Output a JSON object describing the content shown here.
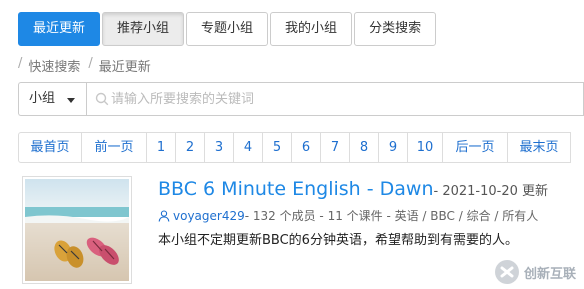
{
  "tabs": [
    {
      "label": "最近更新",
      "state": "active"
    },
    {
      "label": "推荐小组",
      "state": "pressed"
    },
    {
      "label": "专题小组",
      "state": "normal"
    },
    {
      "label": "我的小组",
      "state": "normal"
    },
    {
      "label": "分类搜索",
      "state": "normal"
    }
  ],
  "breadcrumb": [
    "快速搜索",
    "最近更新"
  ],
  "search": {
    "type_label": "小组",
    "placeholder": "请输入所要搜索的关键词"
  },
  "pagination": [
    "最首页",
    "前一页",
    "1",
    "2",
    "3",
    "4",
    "5",
    "6",
    "7",
    "8",
    "9",
    "10",
    "后一页",
    "最末页"
  ],
  "item": {
    "title": "BBC 6 Minute English - Dawn",
    "date_suffix": "- 2021-10-20 更新",
    "user": "voyager429",
    "meta": " - 132 个成员 - 11 个课件 - 英语 / BBC / 综合 / 所有人",
    "description": "本小组不定期更新BBC的6分钟英语，希望帮助到有需要的人。"
  },
  "watermark": {
    "text": "创新互联"
  },
  "colors": {
    "accent": "#1e88e5",
    "link": "#1e6fcf"
  }
}
